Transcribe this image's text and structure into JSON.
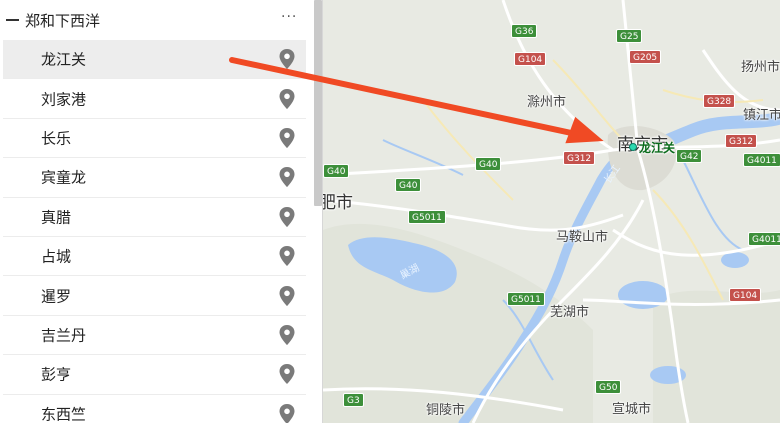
{
  "sidebar": {
    "title": "郑和下西洋",
    "more_icon": "···",
    "items": [
      {
        "label": "龙江关",
        "selected": true
      },
      {
        "label": "刘家港",
        "selected": false
      },
      {
        "label": "长乐",
        "selected": false
      },
      {
        "label": "宾童龙",
        "selected": false
      },
      {
        "label": "真腊",
        "selected": false
      },
      {
        "label": "占城",
        "selected": false
      },
      {
        "label": "暹罗",
        "selected": false
      },
      {
        "label": "吉兰丹",
        "selected": false
      },
      {
        "label": "彭亨",
        "selected": false
      },
      {
        "label": "东西竺",
        "selected": false
      }
    ]
  },
  "map": {
    "marker_label": "龙江关",
    "cities": {
      "nanjing": "南京市",
      "chuzhou": "滁州市",
      "hefei": "肥市",
      "maanshan": "马鞍山市",
      "wuhu": "芜湖市",
      "tongling": "铜陵市",
      "xuancheng": "宣城市",
      "yangzhou": "扬州市",
      "zhenjiang": "镇江市"
    },
    "water_labels": {
      "chaohu": "巢湖",
      "changjiang": "长江"
    },
    "shields": {
      "g36": "G36",
      "g25": "G25",
      "g104_top": "G104",
      "g205": "G205",
      "g328": "G328",
      "g40_a": "G40",
      "g40_b": "G40",
      "g40_c": "G40",
      "g312_a": "G312",
      "g312_b": "G312",
      "g42": "G42",
      "g4011_a": "G4011",
      "g5011_a": "G5011",
      "g5011_b": "G5011",
      "g4011_b": "G4011",
      "g104_bot": "G104",
      "g50": "G50",
      "g3": "G3"
    },
    "colors": {
      "land": "#e8eae3",
      "water": "#a8c9f3",
      "green_shield": "#3d8f3a",
      "red_shield": "#c4514c",
      "arrow": "#f04a24"
    }
  }
}
